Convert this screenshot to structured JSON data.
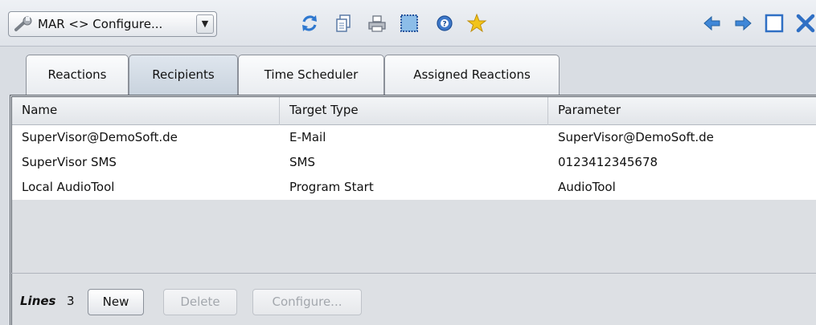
{
  "toolbar": {
    "selector": {
      "value": "MAR <> Configure...",
      "icon": "wrench-icon",
      "arrow": "▼"
    },
    "icons": [
      "refresh-icon",
      "copy-icon",
      "print-icon",
      "select-all-icon",
      "help-icon",
      "favorite-star-icon"
    ],
    "nav_icons": [
      "back-arrow-icon",
      "forward-arrow-icon",
      "maximize-icon",
      "close-icon"
    ],
    "colors": {
      "accent_blue": "#3a7fd5",
      "star_yellow": "#f2c41a"
    }
  },
  "tabs": [
    {
      "label": "Reactions",
      "active": false
    },
    {
      "label": "Recipients",
      "active": true
    },
    {
      "label": "Time Scheduler",
      "active": false
    },
    {
      "label": "Assigned Reactions",
      "active": false
    }
  ],
  "table": {
    "columns": [
      "Name",
      "Target Type",
      "Parameter"
    ],
    "rows": [
      [
        "SuperVisor@DemoSoft.de",
        "E-Mail",
        "SuperVisor@DemoSoft.de"
      ],
      [
        "SuperVisor SMS",
        "SMS",
        "0123412345678"
      ],
      [
        "Local AudioTool",
        "Program Start",
        "AudioTool"
      ]
    ]
  },
  "footer": {
    "lines_label": "Lines",
    "lines_count": "3",
    "buttons": [
      {
        "label": "New",
        "enabled": true
      },
      {
        "label": "Delete",
        "enabled": false
      },
      {
        "label": "Configure...",
        "enabled": false
      }
    ]
  }
}
